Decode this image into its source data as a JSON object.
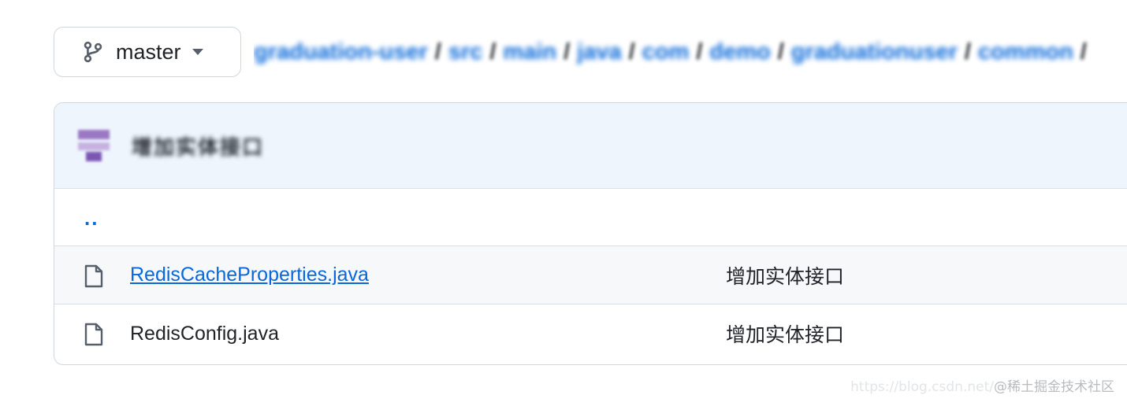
{
  "branch": {
    "label": "master",
    "icon": "git-branch-icon"
  },
  "breadcrumb": {
    "segments": [
      "graduation-user",
      "src",
      "main",
      "java",
      "com",
      "demo",
      "graduationuser",
      "common"
    ],
    "separator": "/",
    "redacted": true
  },
  "commit": {
    "message": "增加实体接口",
    "redacted": true
  },
  "files": {
    "parent_link": "..",
    "rows": [
      {
        "name": "RedisCacheProperties.java",
        "commit_message": "增加实体接口",
        "hovered": true
      },
      {
        "name": "RedisConfig.java",
        "commit_message": "增加实体接口",
        "hovered": false
      }
    ]
  },
  "watermark": {
    "url": "https://blog.csdn.net/",
    "brand": "@稀土掘金技术社区"
  },
  "colors": {
    "link": "#0969da",
    "header_bg": "#eef5fd",
    "border": "#d0d7de",
    "hover_row": "#f6f8fa"
  }
}
